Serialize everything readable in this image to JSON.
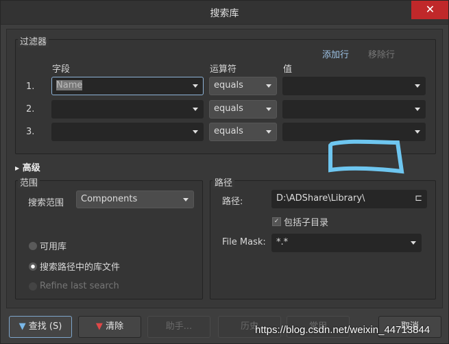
{
  "window": {
    "title": "搜索库",
    "close_icon": "close-icon"
  },
  "filter": {
    "legend": "过滤器",
    "add_row": "添加行",
    "remove_row": "移除行",
    "headers": {
      "field": "字段",
      "operator": "运算符",
      "value": "值"
    },
    "rows": [
      {
        "num": "1.",
        "field": "Name",
        "operator": "equals",
        "value": ""
      },
      {
        "num": "2.",
        "field": "",
        "operator": "equals",
        "value": ""
      },
      {
        "num": "3.",
        "field": "",
        "operator": "equals",
        "value": ""
      }
    ]
  },
  "advanced": {
    "label": "高级"
  },
  "scope": {
    "legend": "范围",
    "search_in_label": "搜索范围",
    "search_in_value": "Components",
    "radio_available": "可用库",
    "radio_path": "搜索路径中的库文件",
    "radio_refine": "Refine last search",
    "selected": "搜索路径中的库文件"
  },
  "path": {
    "legend": "路径",
    "path_label": "路径:",
    "path_value": "D:\\ADShare\\Library\\",
    "include_sub": "包括子目录",
    "include_sub_checked": true,
    "mask_label": "File Mask:",
    "mask_value": "*.*"
  },
  "buttons": {
    "search": "查找 (S)",
    "clear": "清除",
    "helper": "助手...",
    "history": "历史",
    "favorites": "常用",
    "cancel": "取消"
  },
  "watermark": "https://blog.csdn.net/weixin_44713844",
  "annotation_color": "#6ec6f0"
}
